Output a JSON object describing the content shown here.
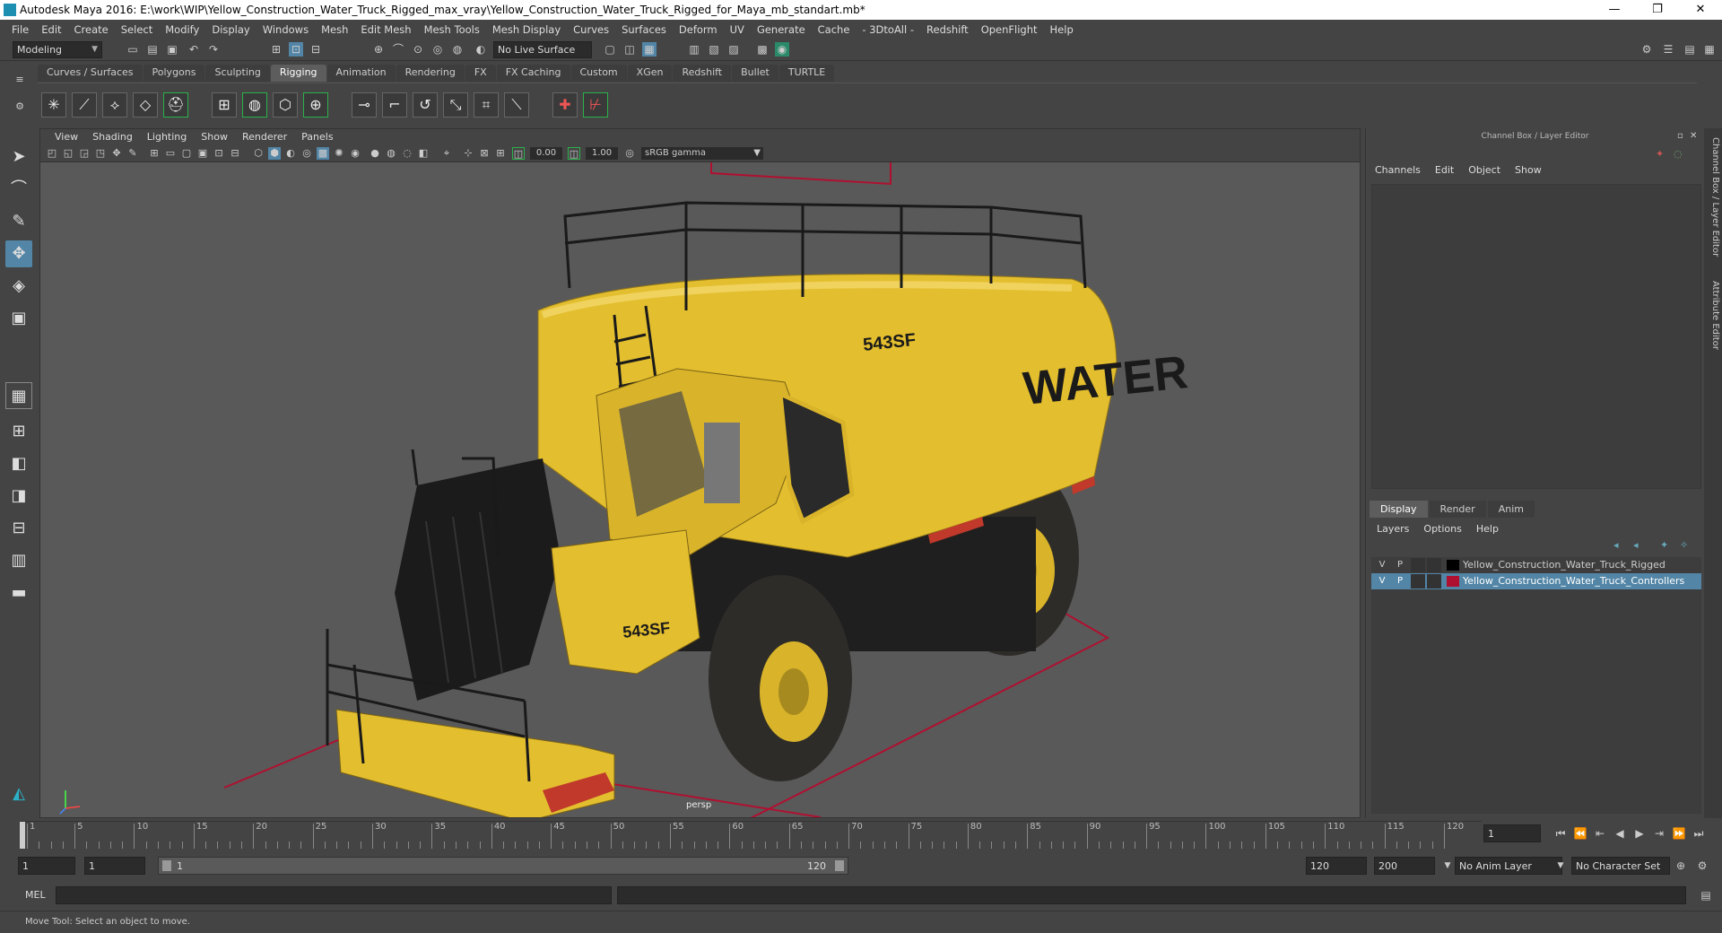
{
  "window": {
    "title": "Autodesk Maya 2016: E:\\work\\WIP\\Yellow_Construction_Water_Truck_Rigged_max_vray\\Yellow_Construction_Water_Truck_Rigged_for_Maya_mb_standart.mb*",
    "minimize": "—",
    "restore": "❐",
    "close": "✕"
  },
  "menubar": [
    "File",
    "Edit",
    "Create",
    "Select",
    "Modify",
    "Display",
    "Windows",
    "Mesh",
    "Edit Mesh",
    "Mesh Tools",
    "Mesh Display",
    "Curves",
    "Surfaces",
    "Deform",
    "UV",
    "Generate",
    "Cache",
    "- 3DtoAll -",
    "Redshift",
    "OpenFlight",
    "Help"
  ],
  "statusline": {
    "mode": "Modeling",
    "live_surface": "No Live Surface"
  },
  "shelf_tabs": [
    "Curves / Surfaces",
    "Polygons",
    "Sculpting",
    "Rigging",
    "Animation",
    "Rendering",
    "FX",
    "FX Caching",
    "Custom",
    "XGen",
    "Redshift",
    "Bullet",
    "TURTLE"
  ],
  "shelf_active": "Rigging",
  "viewport": {
    "menu": [
      "View",
      "Shading",
      "Lighting",
      "Show",
      "Renderer",
      "Panels"
    ],
    "exposure": "0.00",
    "gamma": "1.00",
    "color_space": "sRGB gamma",
    "camera": "persp",
    "truck_text_tank": "WATER",
    "truck_text_model": "543SF"
  },
  "channel_box": {
    "header": "Channel Box / Layer Editor",
    "menu": [
      "Channels",
      "Edit",
      "Object",
      "Show"
    ]
  },
  "layer_editor": {
    "tabs": [
      "Display",
      "Render",
      "Anim"
    ],
    "active_tab": "Display",
    "menu": [
      "Layers",
      "Options",
      "Help"
    ],
    "layers": [
      {
        "v": "V",
        "p": "P",
        "name": "Yellow_Construction_Water_Truck_Rigged",
        "color": "#000000",
        "selected": false
      },
      {
        "v": "V",
        "p": "P",
        "name": "Yellow_Construction_Water_Truck_Controllers",
        "color": "#b01030",
        "selected": true
      }
    ]
  },
  "side_tabs": [
    "Channel Box / Layer Editor",
    "Attribute Editor"
  ],
  "timeline": {
    "ticks": [
      1,
      5,
      10,
      15,
      20,
      25,
      30,
      35,
      40,
      45,
      50,
      55,
      60,
      65,
      70,
      75,
      80,
      85,
      90,
      95,
      100,
      105,
      110,
      115,
      120
    ],
    "current_frame": "1"
  },
  "range": {
    "start": "1",
    "playback_start": "1",
    "slider_label_start": "1",
    "slider_label_end": "120",
    "playback_end": "120",
    "end": "200",
    "anim_layer": "No Anim Layer",
    "character_set": "No Character Set"
  },
  "command": {
    "label": "MEL"
  },
  "help": {
    "text": "Move Tool: Select an object to move."
  },
  "colors": {
    "accent": "#5285a6",
    "ground_curve": "#b01030",
    "truck_yellow": "#e3be2e"
  }
}
